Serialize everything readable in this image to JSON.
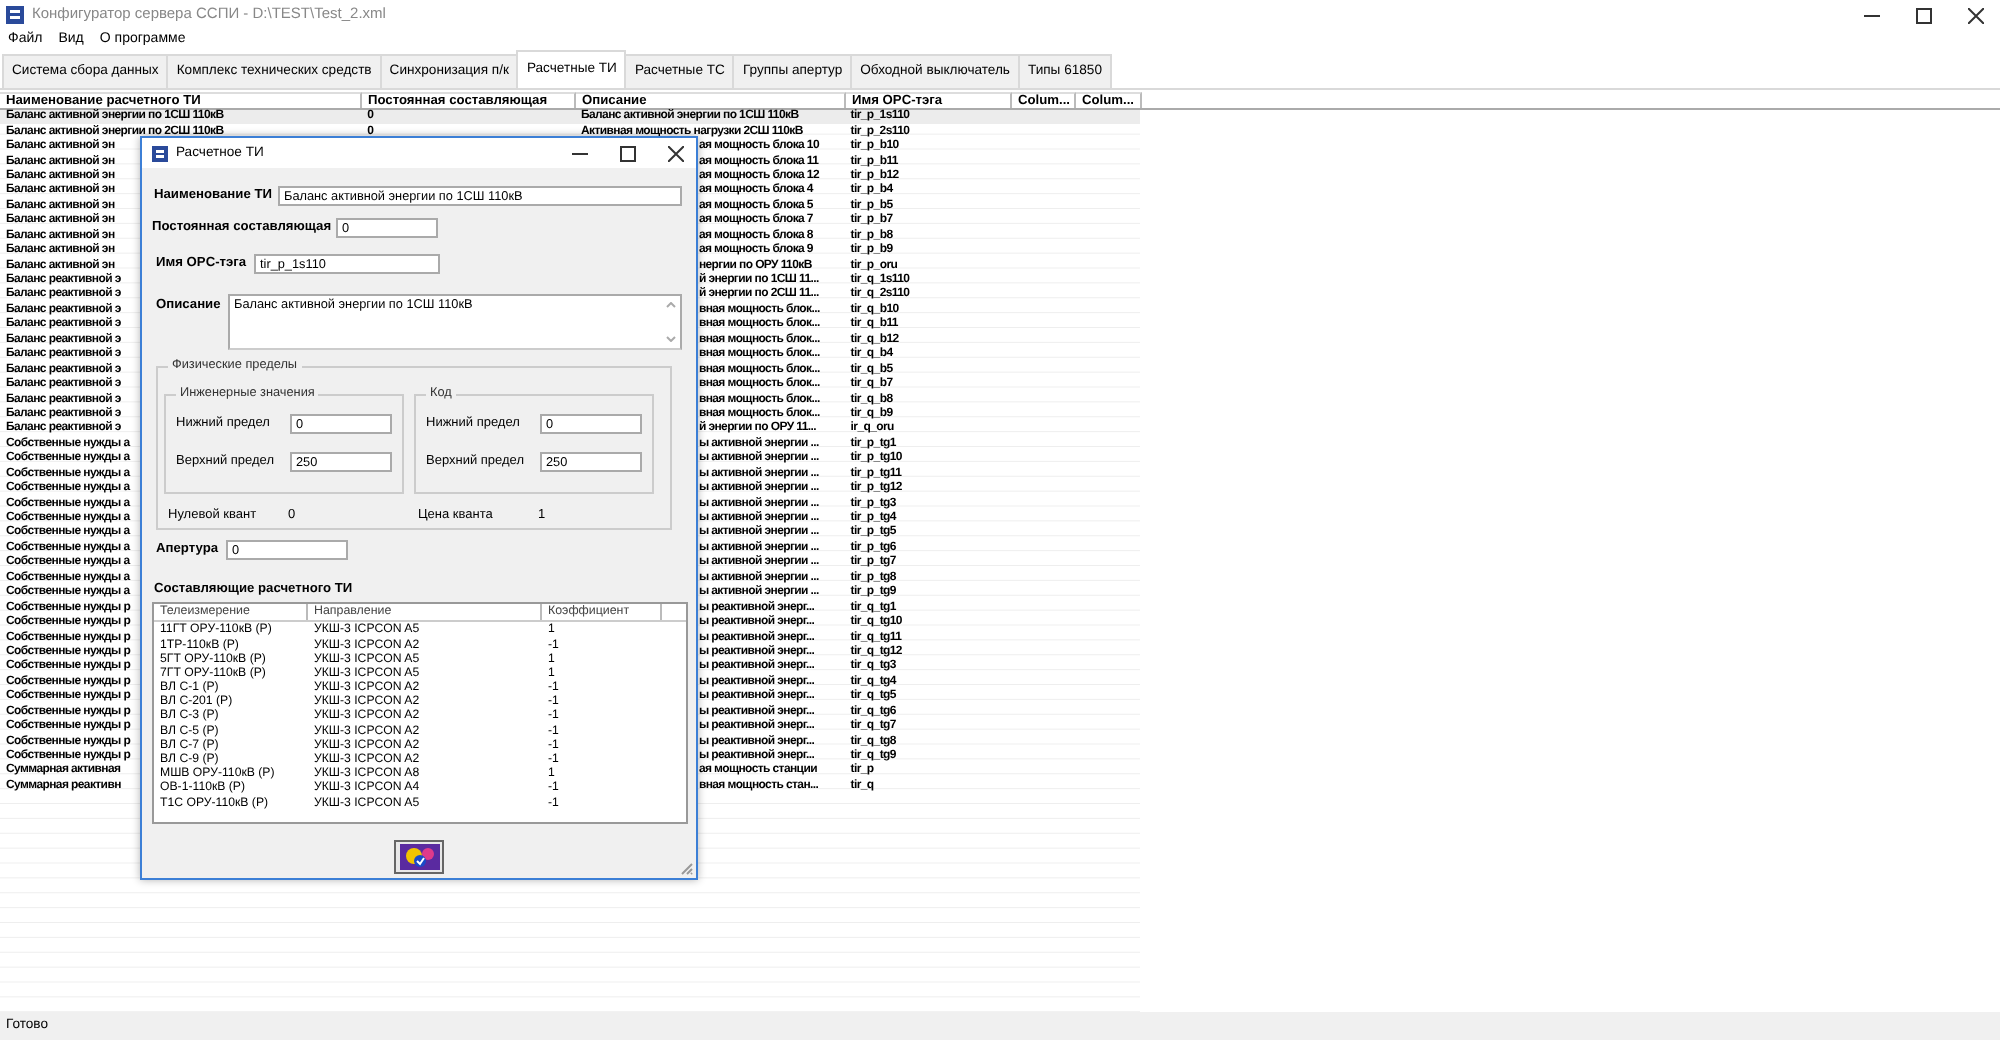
{
  "window": {
    "title": "Конфигуратор сервера ССПИ - D:\\TEST\\Test_2.xml"
  },
  "menu": [
    "Файл",
    "Вид",
    "О программе"
  ],
  "tabs": [
    {
      "label": "Система сбора данных",
      "selected": false
    },
    {
      "label": "Комплекс технических средств",
      "selected": false
    },
    {
      "label": "Синхронизация п/к",
      "selected": false
    },
    {
      "label": "Расчетные ТИ",
      "selected": true
    },
    {
      "label": "Расчетные ТС",
      "selected": false
    },
    {
      "label": "Группы апертур",
      "selected": false
    },
    {
      "label": "Обходной выключатель",
      "selected": false
    },
    {
      "label": "Типы 61850",
      "selected": false
    }
  ],
  "table": {
    "columns": [
      "Наименование расчетного ТИ",
      "Постоянная составляющая",
      "Описание",
      "Имя OPC-тэга",
      "Colum...",
      "Colum..."
    ],
    "rows": [
      {
        "name": "Баланс активной энергии по 1СШ 110кВ",
        "constant": "0",
        "description": "Баланс активной энергии по 1СШ 110кВ",
        "tag": "tir_p_1s110",
        "selected": true
      },
      {
        "name": "Баланс активной энергии по 2СШ 110кВ",
        "constant": "0",
        "description": "Активная мощность нагрузки 2СШ 110кВ",
        "tag": "tir_p_2s110",
        "selected": false
      },
      {
        "name": "Баланс активной эн",
        "description": "ая мощность блока 10",
        "tag": "tir_p_b10",
        "selected": false
      },
      {
        "name": "Баланс активной эн",
        "description": "ая мощность блока 11",
        "tag": "tir_p_b11",
        "selected": false
      },
      {
        "name": "Баланс активной эн",
        "description": "ая мощность блока 12",
        "tag": "tir_p_b12",
        "selected": false
      },
      {
        "name": "Баланс активной эн",
        "description": "ая мощность блока 4",
        "tag": "tir_p_b4",
        "selected": false
      },
      {
        "name": "Баланс активной эн",
        "description": "ая мощность блока 5",
        "tag": "tir_p_b5",
        "selected": false
      },
      {
        "name": "Баланс активной эн",
        "description": "ая мощность блока 7",
        "tag": "tir_p_b7",
        "selected": false
      },
      {
        "name": "Баланс активной эн",
        "description": "ая мощность блока 8",
        "tag": "tir_p_b8",
        "selected": false
      },
      {
        "name": "Баланс активной эн",
        "description": "ая мощность блока 9",
        "tag": "tir_p_b9",
        "selected": false
      },
      {
        "name": "Баланс активной эн",
        "description": "нергии по ОРУ 110кВ",
        "tag": "tir_p_oru",
        "selected": false
      },
      {
        "name": "Баланс реактивной э",
        "description": "й энергии по 1СШ 11...",
        "tag": "tir_q_1s110",
        "selected": false
      },
      {
        "name": "Баланс реактивной э",
        "description": "й энергии по 2СШ 11...",
        "tag": "tir_q_2s110",
        "selected": false
      },
      {
        "name": "Баланс реактивной э",
        "description": "вная мощность блок...",
        "tag": "tir_q_b10",
        "selected": false
      },
      {
        "name": "Баланс реактивной э",
        "description": "вная мощность блок...",
        "tag": "tir_q_b11",
        "selected": false
      },
      {
        "name": "Баланс реактивной э",
        "description": "вная мощность блок...",
        "tag": "tir_q_b12",
        "selected": false
      },
      {
        "name": "Баланс реактивной э",
        "description": "вная мощность блок...",
        "tag": "tir_q_b4",
        "selected": false
      },
      {
        "name": "Баланс реактивной э",
        "description": "вная мощность блок...",
        "tag": "tir_q_b5",
        "selected": false
      },
      {
        "name": "Баланс реактивной э",
        "description": "вная мощность блок...",
        "tag": "tir_q_b7",
        "selected": false
      },
      {
        "name": "Баланс реактивной э",
        "description": "вная мощность блок...",
        "tag": "tir_q_b8",
        "selected": false
      },
      {
        "name": "Баланс реактивной э",
        "description": "вная мощность блок...",
        "tag": "tir_q_b9",
        "selected": false
      },
      {
        "name": "Баланс реактивной э",
        "description": "й энергии по ОРУ 11...",
        "tag": "ir_q_oru",
        "selected": false
      },
      {
        "name": "Собственные нужды а",
        "description": "ы активной энергии ...",
        "tag": "tir_p_tg1",
        "selected": false
      },
      {
        "name": "Собственные нужды а",
        "description": "ы активной энергии ...",
        "tag": "tir_p_tg10",
        "selected": false
      },
      {
        "name": "Собственные нужды а",
        "description": "ы активной энергии ...",
        "tag": "tir_p_tg11",
        "selected": false
      },
      {
        "name": "Собственные нужды а",
        "description": "ы активной энергии ...",
        "tag": "tir_p_tg12",
        "selected": false
      },
      {
        "name": "Собственные нужды а",
        "description": "ы активной энергии ...",
        "tag": "tir_p_tg3",
        "selected": false
      },
      {
        "name": "Собственные нужды а",
        "description": "ы активной энергии ...",
        "tag": "tir_p_tg4",
        "selected": false
      },
      {
        "name": "Собственные нужды а",
        "description": "ы активной энергии ...",
        "tag": "tir_p_tg5",
        "selected": false
      },
      {
        "name": "Собственные нужды а",
        "description": "ы активной энергии ...",
        "tag": "tir_p_tg6",
        "selected": false
      },
      {
        "name": "Собственные нужды а",
        "description": "ы активной энергии ...",
        "tag": "tir_p_tg7",
        "selected": false
      },
      {
        "name": "Собственные нужды а",
        "description": "ы активной энергии ...",
        "tag": "tir_p_tg8",
        "selected": false
      },
      {
        "name": "Собственные нужды а",
        "description": "ы активной энергии ...",
        "tag": "tir_p_tg9",
        "selected": false
      },
      {
        "name": "Собственные нужды р",
        "description": "ы реактивной энерг...",
        "tag": "tir_q_tg1",
        "selected": false
      },
      {
        "name": "Собственные нужды р",
        "description": "ы реактивной энерг...",
        "tag": "tir_q_tg10",
        "selected": false
      },
      {
        "name": "Собственные нужды р",
        "description": "ы реактивной энерг...",
        "tag": "tir_q_tg11",
        "selected": false
      },
      {
        "name": "Собственные нужды р",
        "description": "ы реактивной энерг...",
        "tag": "tir_q_tg12",
        "selected": false
      },
      {
        "name": "Собственные нужды р",
        "description": "ы реактивной энерг...",
        "tag": "tir_q_tg3",
        "selected": false
      },
      {
        "name": "Собственные нужды р",
        "description": "ы реактивной энерг...",
        "tag": "tir_q_tg4",
        "selected": false
      },
      {
        "name": "Собственные нужды р",
        "description": "ы реактивной энерг...",
        "tag": "tir_q_tg5",
        "selected": false
      },
      {
        "name": "Собственные нужды р",
        "description": "ы реактивной энерг...",
        "tag": "tir_q_tg6",
        "selected": false
      },
      {
        "name": "Собственные нужды р",
        "description": "ы реактивной энерг...",
        "tag": "tir_q_tg7",
        "selected": false
      },
      {
        "name": "Собственные нужды р",
        "description": "ы реактивной энерг...",
        "tag": "tir_q_tg8",
        "selected": false
      },
      {
        "name": "Собственные нужды р",
        "description": "ы реактивной энерг...",
        "tag": "tir_q_tg9",
        "selected": false
      },
      {
        "name": "Суммарная активная",
        "description": "ая мощность станции",
        "tag": "tir_p",
        "selected": false
      },
      {
        "name": "Суммарная реактивн",
        "description": "вная мощность стан...",
        "tag": "tir_q",
        "selected": false
      }
    ]
  },
  "dialog": {
    "title": "Расчетное ТИ",
    "name_label": "Наименование ТИ",
    "name_value": "Баланс активной энергии по 1СШ 110кВ",
    "constant_label": "Постоянная составляющая",
    "constant_value": "0",
    "tag_label": "Имя OPC-тэга",
    "tag_value": "tir_p_1s110",
    "description_label": "Описание",
    "description_value": "Баланс активной энергии по 1СШ 110кВ",
    "limits": {
      "title": "Физические пределы",
      "groups": [
        {
          "title": "Инженерные значения",
          "low_label": "Нижний предел",
          "low_value": "0",
          "high_label": "Верхний предел",
          "high_value": "250"
        },
        {
          "title": "Код",
          "low_label": "Нижний предел",
          "low_value": "0",
          "high_label": "Верхний предел",
          "high_value": "250"
        }
      ],
      "zero_label": "Нулевой квант",
      "zero_value": "0",
      "price_label": "Цена кванта",
      "price_value": "1"
    },
    "aperture_label": "Апертура",
    "aperture_value": "0",
    "components_label": "Составляющие расчетного ТИ",
    "components": {
      "columns": [
        "Телеизмерение",
        "Направление",
        "Коэффициент"
      ],
      "rows": [
        [
          "11ГТ ОРУ-110кВ (P)",
          "УКШ-3 ICPCON A5",
          "1"
        ],
        [
          "1ТР-110кВ (P)",
          "УКШ-3 ICPCON A2",
          "-1"
        ],
        [
          "5ГТ ОРУ-110кВ (P)",
          "УКШ-3 ICPCON A5",
          "1"
        ],
        [
          "7ГТ ОРУ-110кВ (P)",
          "УКШ-3 ICPCON A5",
          "1"
        ],
        [
          "ВЛ С-1 (P)",
          "УКШ-3 ICPCON A2",
          "-1"
        ],
        [
          "ВЛ С-201 (P)",
          "УКШ-3 ICPCON A2",
          "-1"
        ],
        [
          "ВЛ С-3 (P)",
          "УКШ-3 ICPCON A2",
          "-1"
        ],
        [
          "ВЛ С-5 (P)",
          "УКШ-3 ICPCON A2",
          "-1"
        ],
        [
          "ВЛ С-7 (P)",
          "УКШ-3 ICPCON A2",
          "-1"
        ],
        [
          "ВЛ С-9 (P)",
          "УКШ-3 ICPCON A2",
          "-1"
        ],
        [
          "МШВ ОРУ-110кВ (P)",
          "УКШ-3 ICPCON A8",
          "1"
        ],
        [
          "ОВ-1-110кВ (P)",
          "УКШ-3 ICPCON A4",
          "-1"
        ],
        [
          "Т1С ОРУ-110кВ (P)",
          "УКШ-3 ICPCON A5",
          "-1"
        ]
      ]
    }
  },
  "status_bar": "Готово"
}
